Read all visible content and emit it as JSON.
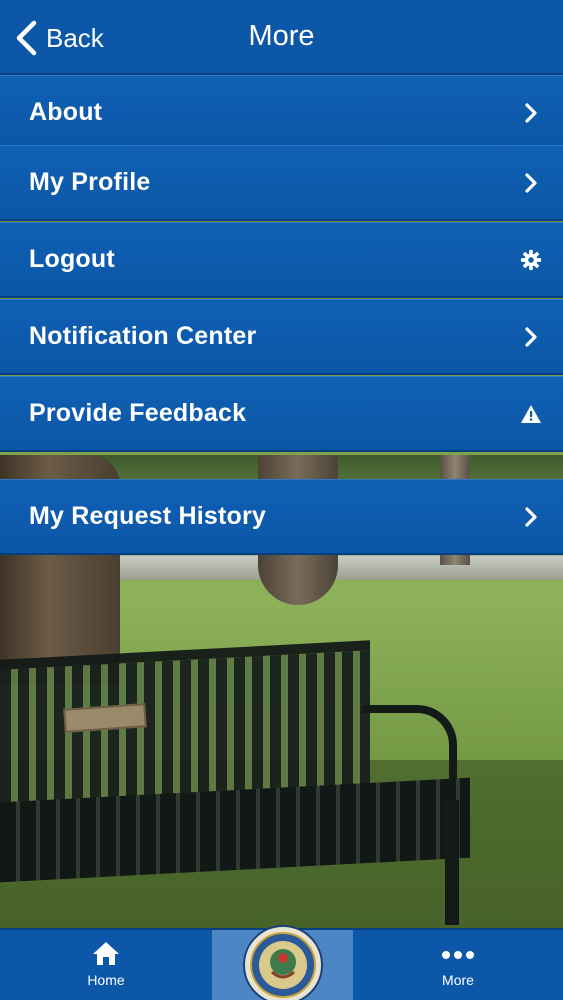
{
  "nav": {
    "back_label": "Back",
    "title": "More"
  },
  "menu": {
    "items": [
      {
        "label": "About",
        "icon": "chevron-right-icon"
      },
      {
        "label": "My Profile",
        "icon": "chevron-right-icon"
      },
      {
        "label": "Logout",
        "icon": "gear-icon"
      },
      {
        "label": "Notification Center",
        "icon": "chevron-right-icon"
      },
      {
        "label": "Provide Feedback",
        "icon": "warning-icon"
      },
      {
        "label": "My Request History",
        "icon": "chevron-right-icon"
      }
    ]
  },
  "tabbar": {
    "home_label": "Home",
    "center_icon": "city-seal-icon",
    "more_label": "More"
  },
  "colors": {
    "brand_blue": "#0d57a8",
    "tab_selected": "#4d86c4",
    "text": "#ffffff"
  }
}
